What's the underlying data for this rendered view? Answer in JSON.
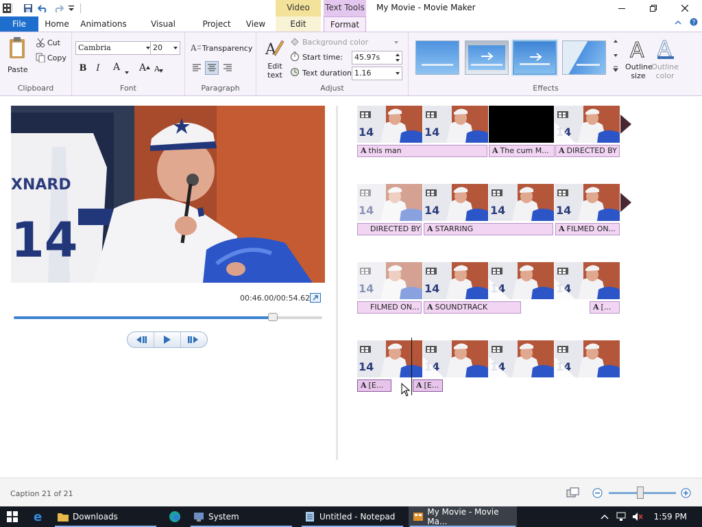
{
  "window": {
    "title": "My Movie - Movie Maker",
    "context_tab_groups": [
      "Video Tools",
      "Text Tools"
    ]
  },
  "ribbon_tabs": {
    "file": "File",
    "home": "Home",
    "animations": "Animations",
    "visual_effects": "Visual Effects",
    "project": "Project",
    "view": "View",
    "edit": "Edit",
    "format": "Format",
    "active": "Format"
  },
  "clipboard": {
    "paste": "Paste",
    "cut": "Cut",
    "copy": "Copy",
    "group_label": "Clipboard"
  },
  "font": {
    "family": "Cambria",
    "size": "20",
    "bold": "B",
    "italic": "I",
    "color": "A",
    "grow": "A",
    "shrink": "A",
    "group_label": "Font"
  },
  "paragraph": {
    "transparency": "Transparency",
    "alignment": "center",
    "group_label": "Paragraph"
  },
  "adjust": {
    "edit_text": "Edit text",
    "background_color": "Background color",
    "start_time_label": "Start time:",
    "start_time": "45.97s",
    "duration_label": "Text duration:",
    "duration": "1.16",
    "group_label": "Adjust"
  },
  "effects": {
    "group_label": "Effects",
    "selected_index": 2,
    "outline_size": "Outline size",
    "outline_color": "Outline color"
  },
  "preview": {
    "time_readout": "00:46.00/00:54.62",
    "progress_fraction": 0.84,
    "jersey_name": "XNARD",
    "jersey_number": "14"
  },
  "storyboard": {
    "rows": [
      {
        "clips": [
          "normal",
          "normal",
          "black",
          "transition"
        ],
        "end_arrow": true,
        "captions": [
          {
            "text": "this man",
            "icon": true
          },
          {
            "text": "The cum M...",
            "icon": true
          },
          {
            "text": "DIRECTED BY",
            "icon": true
          }
        ]
      },
      {
        "clips": [
          "faded",
          "normal",
          "normal",
          "normal"
        ],
        "end_arrow": true,
        "captions": [
          {
            "text": "DIRECTED BY",
            "icon": false
          },
          {
            "text": "STARRING",
            "icon": true
          },
          {
            "text": "FILMED ON...",
            "icon": true
          }
        ]
      },
      {
        "clips": [
          "faded",
          "normal",
          "transition",
          "transition"
        ],
        "end_arrow": false,
        "captions": [
          {
            "text": "FILMED ON...",
            "icon": false
          },
          {
            "text": "SOUNDTRACK",
            "icon": true
          },
          {
            "text": "[...",
            "icon": true
          }
        ]
      },
      {
        "clips": [
          "normal",
          "transition",
          "transition",
          "transition"
        ],
        "end_arrow": false,
        "captions": [
          {
            "text": "[E...",
            "icon": true
          },
          {
            "text": "[E...",
            "icon": true
          }
        ]
      }
    ]
  },
  "status": {
    "caption_count": "Caption 21 of 21",
    "zoom_fraction": 0.47
  },
  "taskbar": {
    "items": [
      "Downloads",
      "System",
      "Untitled - Notepad",
      "My Movie - Movie Ma..."
    ],
    "clock": "1:59 PM"
  },
  "colors": {
    "file_tab": "#1e6fcd",
    "video_tools": "#f3e29a",
    "text_tools": "#e4c7ee",
    "caption_bg": "#f1d5f3",
    "taskbar": "#151a22"
  }
}
